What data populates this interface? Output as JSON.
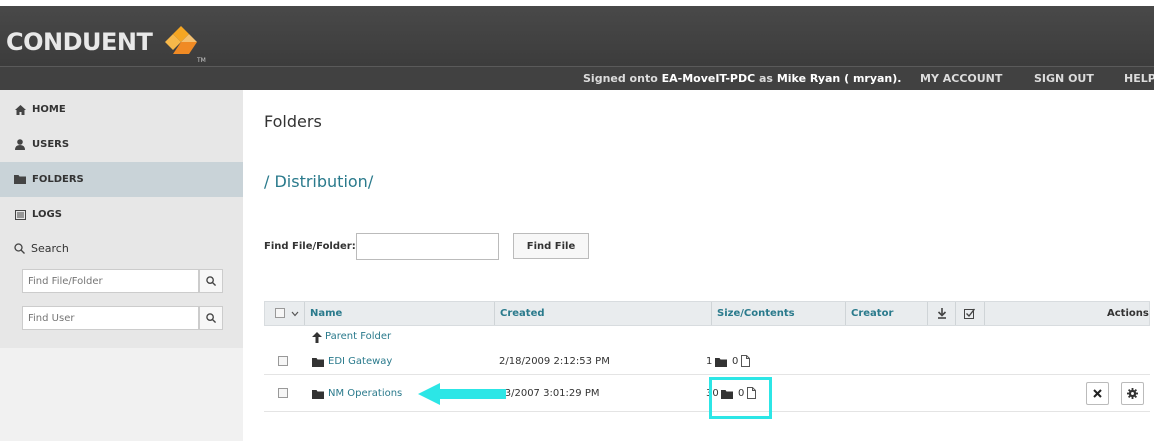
{
  "brand": {
    "logo_text": "CONDUENT",
    "trademark": "TM"
  },
  "header": {
    "signed_prefix": "Signed onto",
    "server": "EA-MoveIT-PDC",
    "signed_middle": "as",
    "user": "Mike Ryan ( mryan).",
    "nav": [
      "MY ACCOUNT",
      "SIGN OUT",
      "HELP"
    ]
  },
  "sidebar": {
    "items": [
      {
        "label": "HOME",
        "icon": "home-icon"
      },
      {
        "label": "USERS",
        "icon": "user-icon"
      },
      {
        "label": "FOLDERS",
        "icon": "folder-icon"
      },
      {
        "label": "LOGS",
        "icon": "logs-icon"
      }
    ],
    "search_label": "Search",
    "find_file_placeholder": "Find File/Folder",
    "find_user_placeholder": "Find User"
  },
  "main": {
    "title": "Folders",
    "path": "/ Distribution/",
    "find_label": "Find File/Folder:",
    "find_button": "Find File"
  },
  "table": {
    "columns": [
      "Name",
      "Created",
      "Size/Contents",
      "Creator",
      "Actions"
    ],
    "parent_folder": "Parent Folder",
    "rows": [
      {
        "name": "EDI Gateway",
        "created": "2/18/2009 2:12:53 PM",
        "folders": "1",
        "files": "0"
      },
      {
        "name": "NM Operations",
        "created": "3/3/2007 3:01:29 PM",
        "folders": "30",
        "files": "0"
      }
    ]
  },
  "colors": {
    "accent": "#2a7a8c",
    "highlight": "#2ce6e6",
    "header_bg": "#414141",
    "sidebar_bg": "#e7e7e7"
  }
}
